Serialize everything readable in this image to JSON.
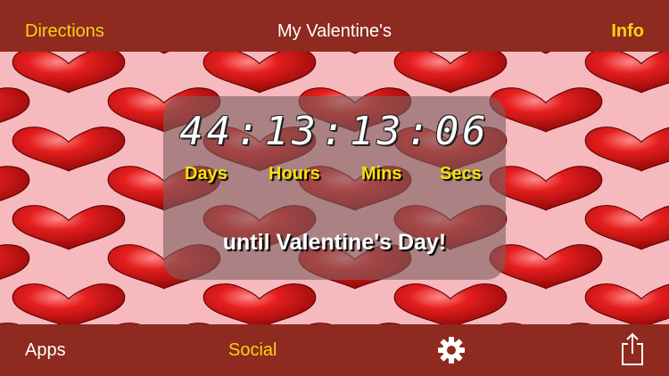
{
  "navbar": {
    "left_label": "Directions",
    "title": "My Valentine's",
    "right_label": "Info"
  },
  "countdown": {
    "days": "44",
    "hours": "13",
    "minutes": "13",
    "seconds": "06",
    "separator": ":",
    "labels": {
      "days": "Days",
      "hours": "Hours",
      "minutes": "Mins",
      "seconds": "Secs"
    },
    "message": "until Valentine's Day!"
  },
  "toolbar": {
    "apps_label": "Apps",
    "social_label": "Social",
    "settings_icon": "gear-icon",
    "share_icon": "share-icon"
  },
  "colors": {
    "bar_background": "#8e2a1f",
    "accent_yellow": "#f5d40f",
    "background_pink": "#f6b9bd",
    "heart_red": "#d61a1a"
  }
}
